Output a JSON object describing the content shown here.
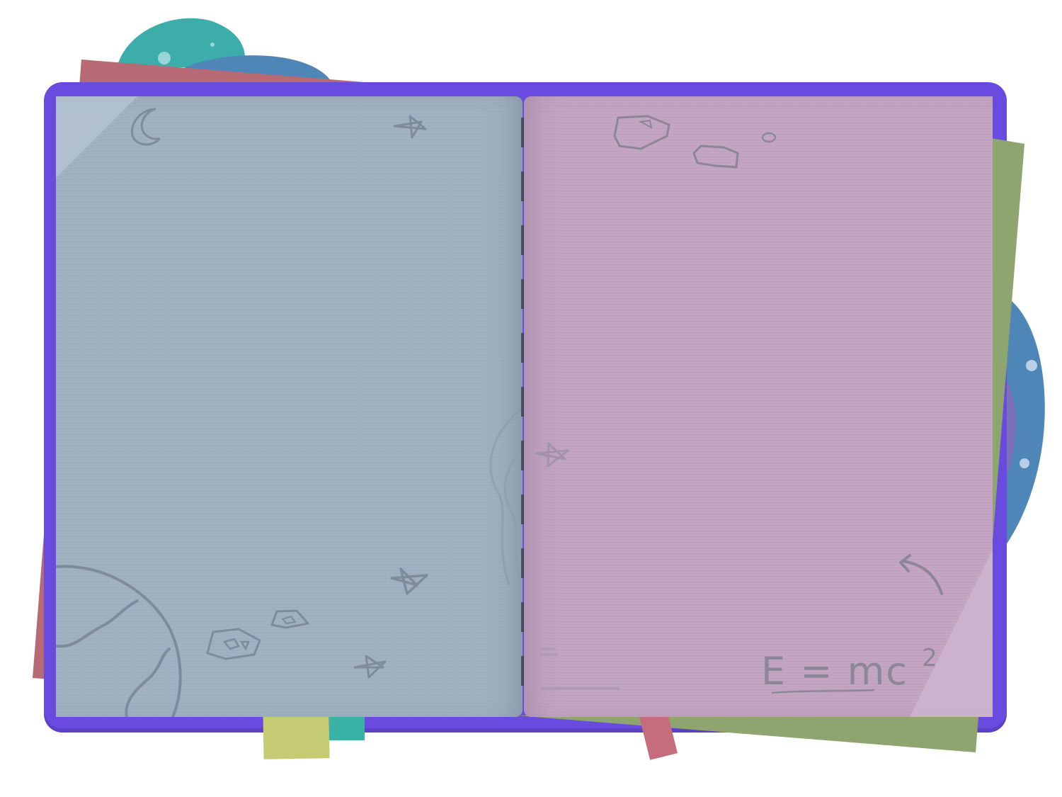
{
  "notebook": {
    "colors": {
      "cover": "#6a4be0",
      "left_page": "#a1b1c3",
      "right_page": "#c3a5c3",
      "red_sheet": "#b86a74",
      "green_sheet": "#8ea56f",
      "yellow_tab": "#c5cb73",
      "teal_tab": "#39b3a6",
      "pink_tab": "#c56c7d",
      "teal_blob": "#3dada9",
      "blue_blob": "#4f86b8",
      "doodle": "#7f8b98"
    },
    "left_page": {
      "doodles": [
        "moon-icon",
        "star-icon",
        "planet-icon",
        "asteroid-icon",
        "star-icon",
        "star-icon"
      ]
    },
    "right_page": {
      "doodles": [
        "asteroid-icon",
        "asteroid-icon",
        "star-icon",
        "curved-arrow-icon"
      ],
      "formula": {
        "base": "E = mc",
        "superscript": "2"
      }
    }
  }
}
